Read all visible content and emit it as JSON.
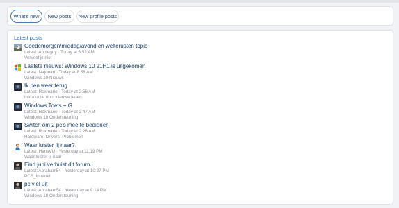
{
  "tabs": [
    {
      "label": "What's new",
      "active": true
    },
    {
      "label": "New posts",
      "active": false
    },
    {
      "label": "New profile posts",
      "active": false
    }
  ],
  "latest": {
    "title": "Latest posts",
    "posts": [
      {
        "title": "Goedemorgen/middag/avond en welterusten topic",
        "meta": "Latest: Appleguy · Today at 8:52 AM",
        "forum": "Verveel je niet",
        "avatar": "bird-photo-avatar"
      },
      {
        "title": "Laatste nieuws: Windows 10 21H1 is uitgekomen",
        "meta": "Latest: Najonart · Today at 8:38 AM",
        "forum": "Windows 10 Nieuws",
        "avatar": "windows-logo-avatar"
      },
      {
        "title": "Ik ben weer terug",
        "meta": "Latest: Roxmarie · Today at 2:56 AM",
        "forum": "Introductie door nieuwe leden",
        "avatar": "dark-photo-avatar"
      },
      {
        "title": "Windows Toets + G",
        "meta": "Latest: Roxmarie · Today at 2:47 AM",
        "forum": "Windows 10 Ondersteuning",
        "avatar": "dark-photo-avatar"
      },
      {
        "title": "Switch om 2 pc's mee te bedienen",
        "meta": "Latest: Roxmarie · Today at 2:26 AM",
        "forum": "Hardware, Drivers, Problemen",
        "avatar": "dark-photo-avatar"
      },
      {
        "title": "Waar luister jij naar?",
        "meta": "Latest: HansVU · Yesterday at 11:19 PM",
        "forum": "Waar luister jij naar",
        "avatar": "cartoon-avatar"
      },
      {
        "title": "Eind juni verhuist dit forum.",
        "meta": "Latest: Abraham54 · Yesterday at 10:27 PM",
        "forum": "PCS_Intranet",
        "avatar": "portrait-avatar"
      },
      {
        "title": "pc viel uit",
        "meta": "Latest: Abraham54 · Yesterday at 9:14 PM",
        "forum": "Windows 10 Ondersteuning",
        "avatar": "portrait-avatar"
      }
    ]
  }
}
